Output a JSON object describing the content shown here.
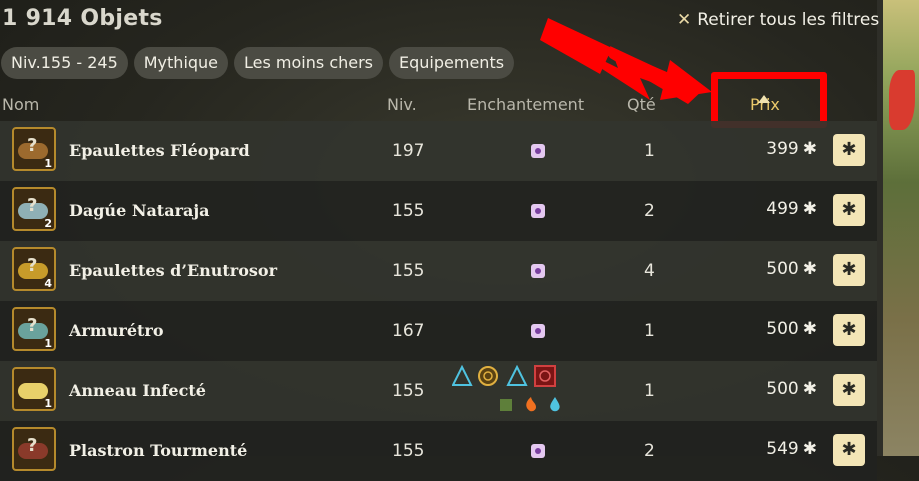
{
  "header": {
    "title": "1 914 Objets",
    "clear_filters": "Retirer tous les filtres"
  },
  "filters": [
    "Niv.155 - 245",
    "Mythique",
    "Les moins chers",
    "Equipements"
  ],
  "columns": {
    "name": "Nom",
    "level": "Niv.",
    "enchant": "Enchantement",
    "qty": "Qté",
    "price": "Prix"
  },
  "rows": [
    {
      "name": "Epaulettes Fléopard",
      "level": "197",
      "qty": "1",
      "price": "399",
      "count": "1",
      "color": "#9c6a2e"
    },
    {
      "name": "Dagúe Nataraja",
      "level": "155",
      "qty": "2",
      "price": "499",
      "count": "2",
      "color": "#8fb0b5"
    },
    {
      "name": "Epaulettes d’Enutrosor",
      "level": "155",
      "qty": "4",
      "price": "500",
      "count": "4",
      "color": "#c79b2a"
    },
    {
      "name": "Armurétro",
      "level": "167",
      "qty": "1",
      "price": "500",
      "count": "1",
      "color": "#6aa29c"
    },
    {
      "name": "Anneau Infecté",
      "level": "155",
      "qty": "1",
      "price": "500",
      "count": "1",
      "color": "#e8d06a"
    },
    {
      "name": "Plastron Tourmenté",
      "level": "155",
      "qty": "2",
      "price": "549",
      "count": "",
      "color": "#8a3a2a"
    }
  ],
  "icons": {
    "currency": "kama-icon",
    "buy": "kama-icon",
    "enchant": "dice-icon",
    "clear": "close-icon"
  },
  "colors": {
    "highlight": "#ff0000",
    "sort_active": "#e9c86a",
    "button": "#f3e5b6"
  }
}
